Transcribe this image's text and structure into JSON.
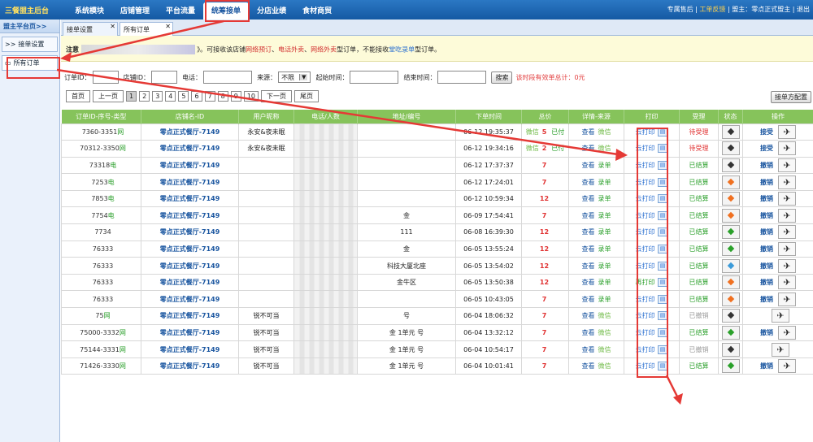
{
  "app": {
    "brand": "三餐盟主后台"
  },
  "nav": {
    "items": [
      "系统模块",
      "店铺管理",
      "平台流量",
      "统筹接单",
      "分店业绩",
      "食材商贸"
    ],
    "active_index": 3
  },
  "topright": {
    "after_sale": "专属售后",
    "divider1": "|",
    "feedback": "工单反馈",
    "divider2": "|",
    "owner": "盟主：零点正式盟主",
    "divider3": "|",
    "logout": "退出"
  },
  "sidebar": {
    "title": "盟主平台页>>",
    "items": [
      {
        "label": "接单设置",
        "icon": ">>"
      },
      {
        "label": "所有订单",
        "icon": "▭"
      }
    ],
    "selected_index": 1
  },
  "tabs": [
    {
      "label": "接单设置"
    },
    {
      "label": "所有订单"
    }
  ],
  "notice": {
    "prefix": "注意",
    "mid": "》。可接收该店铺",
    "r1": "网络预订",
    "s1": "、",
    "r2": "电话外卖",
    "s2": "、",
    "r3": "网络外卖",
    "t1": "型订单，不能接收",
    "b1": "堂吃录单",
    "t2": "型订单。"
  },
  "filters": {
    "order_id_label": "订单ID：",
    "shop_id_label": "店铺ID：",
    "phone_label": "电话：",
    "source_label": "来源：",
    "source_value": "不限",
    "start_label": "起始时间：",
    "end_label": "结束时间：",
    "search_btn": "搜索",
    "effective": "该时段有效单总计：0元"
  },
  "pager": {
    "first": "首页",
    "prev": "上一页",
    "pages": [
      "1",
      "2",
      "3",
      "4",
      "5",
      "6",
      "7",
      "8",
      "9",
      "10"
    ],
    "current": "1",
    "next": "下一页",
    "last": "尾页",
    "config_btn": "接单方配置"
  },
  "table": {
    "headers": [
      "订单ID-序号-类型",
      "店铺名-ID",
      "用户昵称",
      "电话/人数",
      "地址/编号",
      "下单时间",
      "总价",
      "详情-来源",
      "打印",
      "受理",
      "状态",
      "操作"
    ],
    "rows": [
      {
        "id": "7360-3351",
        "type": "网",
        "shop": "零点正式餐厅-7149",
        "nick": "永安&夜未眠",
        "addr": "",
        "time": "06-12 19:35:37",
        "wx": "微信",
        "total": "5",
        "paid": "已付",
        "view": "查看",
        "src": "微信",
        "print": "云打印",
        "status": "待受理",
        "st": "pending",
        "dc": "#333",
        "op": "接受"
      },
      {
        "id": "70312-3350",
        "type": "网",
        "shop": "零点正式餐厅-7149",
        "nick": "永安&夜未眠",
        "addr": "",
        "time": "06-12 19:34:16",
        "wx": "微信",
        "total": "2",
        "paid": "已付",
        "view": "查看",
        "src": "微信",
        "print": "云打印",
        "status": "待受理",
        "st": "pending",
        "dc": "#333",
        "op": "接受"
      },
      {
        "id": "73318",
        "type": "电",
        "shop": "零点正式餐厅-7149",
        "nick": "",
        "addr": "",
        "time": "06-12 17:37:37",
        "wx": "",
        "total": "7",
        "paid": "",
        "view": "查看",
        "src": "录单",
        "print": "云打印",
        "status": "已结算",
        "st": "done",
        "dc": "#333",
        "op": "撤销"
      },
      {
        "id": "7253",
        "type": "电",
        "shop": "零点正式餐厅-7149",
        "nick": "",
        "addr": "",
        "time": "06-12 17:24:01",
        "wx": "",
        "total": "7",
        "paid": "",
        "view": "查看",
        "src": "录单",
        "print": "云打印",
        "status": "已结算",
        "st": "done",
        "dc": "#f07020",
        "op": "撤销"
      },
      {
        "id": "7853",
        "type": "电",
        "shop": "零点正式餐厅-7149",
        "nick": "",
        "addr": "",
        "time": "06-12 10:59:34",
        "wx": "",
        "total": "12",
        "paid": "",
        "view": "查看",
        "src": "录单",
        "print": "云打印",
        "status": "已结算",
        "st": "done",
        "dc": "#f07020",
        "op": "撤销"
      },
      {
        "id": "7754",
        "type": "电",
        "shop": "零点正式餐厅-7149",
        "nick": "",
        "addr": "金",
        "time": "06-09 17:54:41",
        "wx": "",
        "total": "7",
        "paid": "",
        "view": "查看",
        "src": "录单",
        "print": "云打印",
        "status": "已结算",
        "st": "done",
        "dc": "#f07020",
        "op": "撤销"
      },
      {
        "id": "7734",
        "type": "",
        "shop": "零点正式餐厅-7149",
        "nick": "",
        "addr": "111",
        "time": "06-08 16:39:30",
        "wx": "",
        "total": "12",
        "paid": "",
        "view": "查看",
        "src": "录单",
        "print": "云打印",
        "status": "已结算",
        "st": "done",
        "dc": "#2aa02a",
        "op": "撤销"
      },
      {
        "id": "76333",
        "type": "",
        "shop": "零点正式餐厅-7149",
        "nick": "",
        "addr": "金",
        "time": "06-05 13:55:24",
        "wx": "",
        "total": "12",
        "paid": "",
        "view": "查看",
        "src": "录单",
        "print": "云打印",
        "status": "已结算",
        "st": "done",
        "dc": "#2aa02a",
        "op": "撤销"
      },
      {
        "id": "76333",
        "type": "",
        "shop": "零点正式餐厅-7149",
        "nick": "",
        "addr": "科技大厦北座",
        "time": "06-05 13:54:02",
        "wx": "",
        "total": "12",
        "paid": "",
        "view": "查看",
        "src": "录单",
        "print": "云打印",
        "status": "已结算",
        "st": "done",
        "dc": "#3a9ad9",
        "op": "撤销"
      },
      {
        "id": "76333",
        "type": "",
        "shop": "零点正式餐厅-7149",
        "nick": "",
        "addr": "金牛区",
        "time": "06-05 13:50:38",
        "wx": "",
        "total": "12",
        "paid": "",
        "view": "查看",
        "src": "录单",
        "print": "再打印",
        "status": "已结算",
        "st": "done",
        "dc": "#f07020",
        "op": "撤销"
      },
      {
        "id": "76333",
        "type": "",
        "shop": "零点正式餐厅-7149",
        "nick": "",
        "addr": "",
        "time": "06-05 10:43:05",
        "wx": "",
        "total": "7",
        "paid": "",
        "view": "查看",
        "src": "录单",
        "print": "云打印",
        "status": "已结算",
        "st": "done",
        "dc": "#f07020",
        "op": "撤销"
      },
      {
        "id": "75",
        "type": "网",
        "shop": "零点正式餐厅-7149",
        "nick": "锐不可当",
        "addr": "号",
        "time": "06-04 18:06:32",
        "wx": "",
        "total": "7",
        "paid": "",
        "view": "查看",
        "src": "微信",
        "print": "云打印",
        "status": "已撤销",
        "st": "cancel",
        "dc": "#333",
        "op": ""
      },
      {
        "id": "75000-3332",
        "type": "网",
        "shop": "零点正式餐厅-7149",
        "nick": "锐不可当",
        "addr": "金 1单元 号",
        "time": "06-04 13:32:12",
        "wx": "",
        "total": "7",
        "paid": "",
        "view": "查看",
        "src": "微信",
        "print": "云打印",
        "status": "已结算",
        "st": "done",
        "dc": "#2aa02a",
        "op": "撤销"
      },
      {
        "id": "75144-3331",
        "type": "网",
        "shop": "零点正式餐厅-7149",
        "nick": "锐不可当",
        "addr": "金 1单元 号",
        "time": "06-04 10:54:17",
        "wx": "",
        "total": "7",
        "paid": "",
        "view": "查看",
        "src": "微信",
        "print": "云打印",
        "status": "已撤销",
        "st": "cancel",
        "dc": "#333",
        "op": ""
      },
      {
        "id": "71426-3330",
        "type": "网",
        "shop": "零点正式餐厅-7149",
        "nick": "锐不可当",
        "addr": "金 1单元 号",
        "time": "06-04 10:01:41",
        "wx": "",
        "total": "7",
        "paid": "",
        "view": "查看",
        "src": "微信",
        "print": "云打印",
        "status": "已结算",
        "st": "done",
        "dc": "#2aa02a",
        "op": "撤销"
      }
    ]
  }
}
